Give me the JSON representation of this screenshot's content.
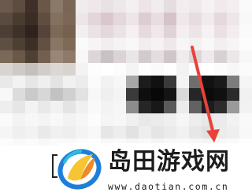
{
  "brand": {
    "title": "岛田游戏网",
    "url": "www.daotian.com.cn"
  },
  "colors": {
    "arrow": "#e8423a",
    "logo_blue": "#1e7fd9",
    "logo_cyan": "#2bbfd8",
    "logo_yellow": "#f6c531",
    "logo_orange": "#f08a24",
    "text_dark": "#1c1c1c"
  },
  "icons": {
    "logo": "daotian-logo-icon",
    "annotation": "red-arrow-icon"
  },
  "screenshot": {
    "note_label": "",
    "tiles": [
      "#6b5a4c",
      "#5d4c40",
      "#3e3028",
      "#6a5748",
      "#8a7868",
      "#7a6654",
      "#f0ecec",
      "#efe8ea",
      "#e9e2e4",
      "#eee8ea",
      "#f4eff0",
      "#ece4e6",
      "#f1ecee",
      "#e6dde0",
      "#f2eeef",
      "#efe9eb",
      "#f6f2f3",
      "#f0eaec",
      "#f3eff0",
      "#fafafa",
      "#5a4a3f",
      "#4a3b31",
      "#3a2d25",
      "#5f4d40",
      "#85705f",
      "#7c6756",
      "#ece6e8",
      "#e2d6da",
      "#d8c8ce",
      "#e4d8dc",
      "#ede5e8",
      "#dccdd2",
      "#e8dee1",
      "#d4c3c9",
      "#efe7ea",
      "#e7dce0",
      "#f1eaed",
      "#e5d9dd",
      "#eee6e9",
      "#f9f8f8",
      "#4c3e34",
      "#3d3129",
      "#2e231d",
      "#54443a",
      "#7d6957",
      "#766150",
      "#f3efef",
      "#ebe2e5",
      "#e4d8dc",
      "#ece3e6",
      "#f5eff1",
      "#e6dadf",
      "#efe7ea",
      "#e0d3d8",
      "#f4eef0",
      "#ede4e7",
      "#f6f1f3",
      "#ebe1e5",
      "#f3edef",
      "#fbfafa",
      "#5f4e42",
      "#4e3f35",
      "#3b2f27",
      "#625043",
      "#8a7665",
      "#7f6a58",
      "#fbfafa",
      "#f7f4f5",
      "#f2eeef",
      "#f6f3f4",
      "#f9f7f8",
      "#f1ecee",
      "#f6f2f4",
      "#eee8ea",
      "#f8f5f6",
      "#f4f0f2",
      "#f9f7f8",
      "#f3eef0",
      "#f7f4f5",
      "#fcfcfc",
      "#7a6858",
      "#6a5848",
      "#4f4036",
      "#735f4f",
      "#9a8676",
      "#8e7a68",
      "#f8f6f6",
      "#dcd6d8",
      "#c9c1c4",
      "#dbd4d7",
      "#eae6e7",
      "#d2cacd",
      "#e3dddf",
      "#cfc6ca",
      "#efebec",
      "#ddd6d9",
      "#eeeaeb",
      "#d8d1d4",
      "#ebe7e8",
      "#f9f8f8",
      "#d8d4d2",
      "#cfcac7",
      "#c6c0bc",
      "#d3cdc9",
      "#dcd7d4",
      "#d9d3cf",
      "#f4f2f2",
      "#fdfdfd",
      "#ffffff",
      "#fcfcfc",
      "#f5f4f4",
      "#fdfdfd",
      "#fafafa",
      "#fefefe",
      "#f3f2f2",
      "#fcfcfc",
      "#ffffff",
      "#fbfbfb",
      "#f8f7f7",
      "#fbfbfb",
      "#e9e9e9",
      "#f2f2f2",
      "#e6e6e6",
      "#efefef",
      "#e3e3e3",
      "#f1f1f1",
      "#ececec",
      "#fbfbfb",
      "#f2f2f2",
      "#f7f7f7",
      "#a8a8a8",
      "#1c1c1c",
      "#111111",
      "#3a3a3a",
      "#f4f4f4",
      "#6e6e6e",
      "#121212",
      "#1a1a1a",
      "#7c7c7c",
      "#f5f5f5",
      "#f8f8f8",
      "#dcdcdc",
      "#cacaca",
      "#d7d7d7",
      "#c2c2c2",
      "#d0d0d0",
      "#e2e2e2",
      "#f7f7f7",
      "#efefef",
      "#f4f4f4",
      "#3a3a3a",
      "#0e0e0e",
      "#080808",
      "#141414",
      "#d9d9d9",
      "#262626",
      "#0c0c0c",
      "#101010",
      "#2a2a2a",
      "#f1f1f1",
      "#eeeeee",
      "#e6e6e6",
      "#f3f3f3",
      "#e9e9e9",
      "#f1f1f1",
      "#e4e4e4",
      "#f0f0f0",
      "#f9f9f9",
      "#f3f3f3",
      "#f6f6f6",
      "#8c8c8c",
      "#262626",
      "#181818",
      "#5a5a5a",
      "#ececec",
      "#626262",
      "#1c1c1c",
      "#2c2c2c",
      "#9a9a9a",
      "#f2f2f2",
      "#fafafa",
      "#f3f3f3",
      "#f7f7f7",
      "#f4f4f4",
      "#f8f8f8",
      "#f2f2f2",
      "#f6f6f6",
      "#fcfcfc",
      "#f5f5f5",
      "#f7f7f7",
      "#f0f0f0",
      "#e9e9e9",
      "#ebebeb",
      "#efefef",
      "#f6f6f6",
      "#ededed",
      "#e8e8e8",
      "#ebebeb",
      "#f2f2f2",
      "#f9f9f9",
      "#f5f5f5",
      "#efefef",
      "#f2f2f2",
      "#e9e9e9",
      "#f0f0f0",
      "#eeeeee",
      "#f4f4f4",
      "#f8f8f8",
      "#e6e6e6",
      "#ededed",
      "#e2e2e2",
      "#eeeeee",
      "#e5e5e5",
      "#ebebeb",
      "#f1f1f1",
      "#e7e7e7",
      "#e0e0e0",
      "#ececec",
      "#efefef",
      "#f8f8f8",
      "#fcfcfc",
      "#f9f9f9",
      "#fbfbfb",
      "#f8f8f8",
      "#fbfbfb",
      "#f9f9f9",
      "#fcfcfc",
      "#fdfdfd",
      "#f8f8f8",
      "#fafafa",
      "#f6f6f6",
      "#f9f9f9",
      "#f5f5f5",
      "#f8f8f8",
      "#fafafa",
      "#f7f7f7",
      "#f4f4f4",
      "#f8f8f8",
      "#fafafa",
      "#fdfdfd"
    ]
  }
}
